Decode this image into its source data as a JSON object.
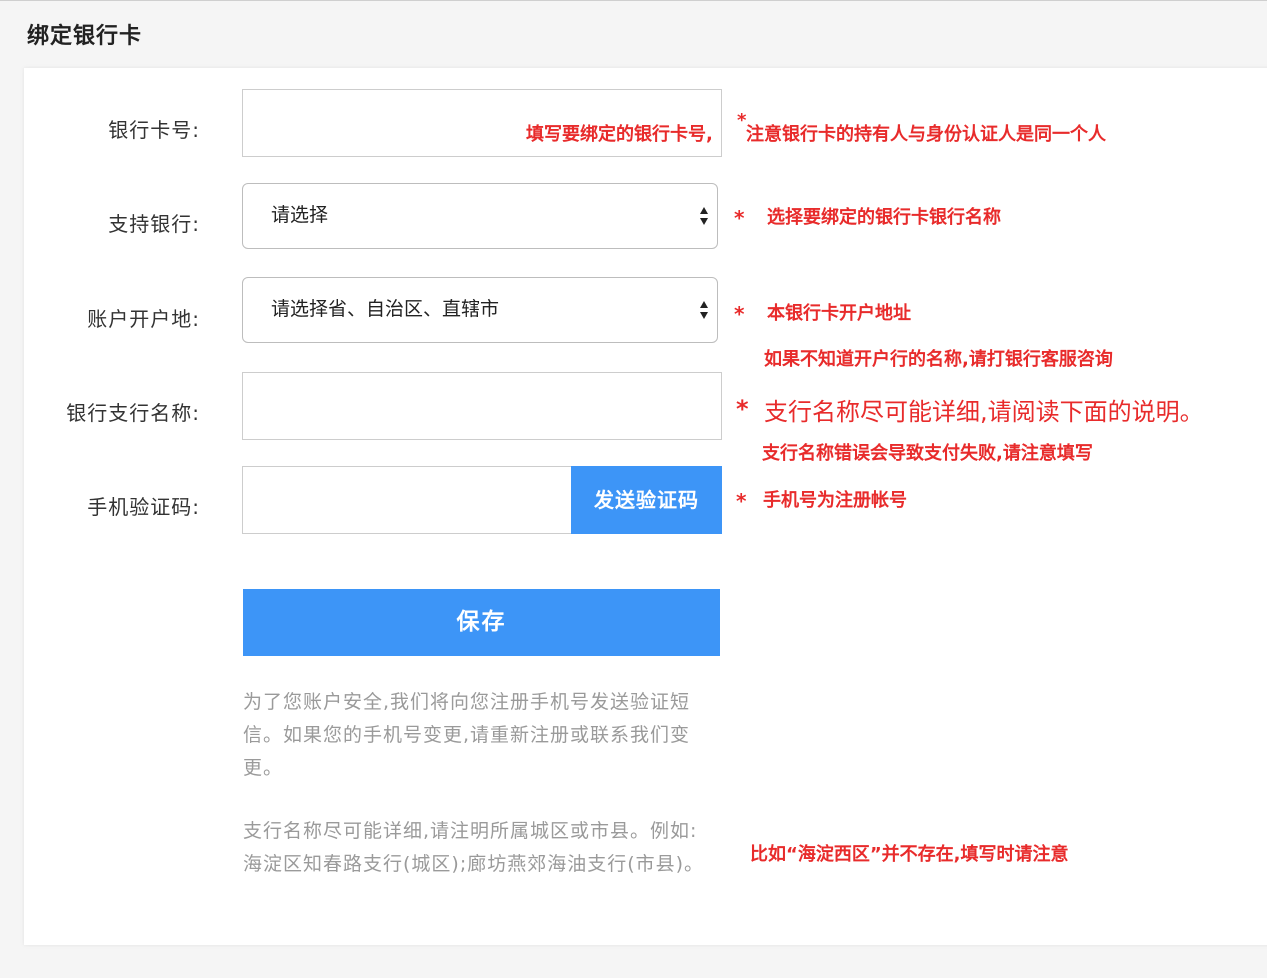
{
  "page": {
    "title": "绑定银行卡"
  },
  "form": {
    "card_number_label": "银行卡号:",
    "bank_label": "支持银行:",
    "bank_select_value": "请选择",
    "region_label": "账户开户地:",
    "region_select_value": "请选择省、自治区、直辖市",
    "branch_label": "银行支行名称:",
    "sms_label": "手机验证码:",
    "send_code_button": "发送验证码",
    "save_button": "保存"
  },
  "info": {
    "security_text": "为了您账户安全,我们将向您注册手机号发送验证短信。如果您的手机号变更,请重新注册或联系我们变更。",
    "branch_text": "支行名称尽可能详细,请注明所属城区或市县。例如:海淀区知春路支行(城区);廊坊燕郊海油支行(市县)。"
  },
  "annotations": {
    "star": "*",
    "card_note_a": "填写要绑定的银行卡号,",
    "card_note_b": "注意银行卡的持有人与身份认证人是同一个人",
    "bank_note": "选择要绑定的银行卡银行名称",
    "region_note": "本银行卡开户地址",
    "region_note_2": "如果不知道开户行的名称,请打银行客服咨询",
    "branch_note": "支行名称尽可能详细,请阅读下面的说明。",
    "branch_note_2": "支行名称错误会导致支付失败,请注意填写",
    "sms_note": "手机号为注册帐号",
    "example_note": "比如“海淀西区”并不存在,填写时请注意"
  },
  "colors": {
    "accent": "#3d95f7",
    "annotation": "#e82b2b",
    "hint_text": "#9a9a9a"
  },
  "icons": {
    "select_arrows": "chevron-up-down-icon"
  }
}
